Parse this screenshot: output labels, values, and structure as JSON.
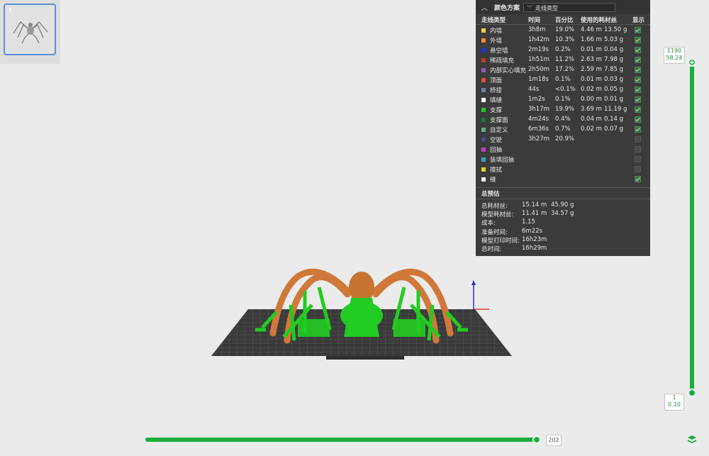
{
  "thumbnail": {
    "number": "1"
  },
  "panel": {
    "title": "颜色方案",
    "scheme": "走线类型",
    "columns": [
      "走线类型",
      "时间",
      "百分比",
      "使用的耗材丝",
      "显示"
    ],
    "rows": [
      {
        "color": "#f2d33c",
        "name": "内墙",
        "time": "3h8m",
        "pct": "19.0%",
        "len": "4.46 m",
        "weight": "13.50 g",
        "shown": true
      },
      {
        "color": "#f28c35",
        "name": "外墙",
        "time": "1h42m",
        "pct": "10.3%",
        "len": "1.66 m",
        "weight": "5.03 g",
        "shown": true
      },
      {
        "color": "#2033d9",
        "name": "悬空墙",
        "time": "2m19s",
        "pct": "0.2%",
        "len": "0.01 m",
        "weight": "0.04 g",
        "shown": true
      },
      {
        "color": "#c0392b",
        "name": "稀疏填充",
        "time": "1h51m",
        "pct": "11.2%",
        "len": "2.63 m",
        "weight": "7.98 g",
        "shown": true
      },
      {
        "color": "#9b59b6",
        "name": "内部实心填充",
        "time": "2h50m",
        "pct": "17.2%",
        "len": "2.59 m",
        "weight": "7.85 g",
        "shown": true
      },
      {
        "color": "#e74c3c",
        "name": "顶面",
        "time": "1m18s",
        "pct": "0.1%",
        "len": "0.01 m",
        "weight": "0.03 g",
        "shown": true
      },
      {
        "color": "#6b7fa8",
        "name": "桥接",
        "time": "44s",
        "pct": "<0.1%",
        "len": "0.02 m",
        "weight": "0.05 g",
        "shown": true
      },
      {
        "color": "#ffffff",
        "name": "填缝",
        "time": "1m2s",
        "pct": "0.1%",
        "len": "0.00 m",
        "weight": "0.01 g",
        "shown": true
      },
      {
        "color": "#22cc22",
        "name": "支撑",
        "time": "3h17m",
        "pct": "19.9%",
        "len": "3.69 m",
        "weight": "11.19 g",
        "shown": true
      },
      {
        "color": "#157a3a",
        "name": "支撑面",
        "time": "4m24s",
        "pct": "0.4%",
        "len": "0.04 m",
        "weight": "0.14 g",
        "shown": true
      },
      {
        "color": "#5fae7a",
        "name": "自定义",
        "time": "6m36s",
        "pct": "0.7%",
        "len": "0.02 m",
        "weight": "0.07 g",
        "shown": true
      },
      {
        "color": "#4a4a8a",
        "name": "空驶",
        "time": "3h27m",
        "pct": "20.9%",
        "len": "",
        "weight": "",
        "shown": false
      },
      {
        "color": "#c040c0",
        "name": "回抽",
        "time": "",
        "pct": "",
        "len": "",
        "weight": "",
        "shown": false
      },
      {
        "color": "#3aa0c8",
        "name": "装填回抽",
        "time": "",
        "pct": "",
        "len": "",
        "weight": "",
        "shown": false
      },
      {
        "color": "#e6d020",
        "name": "擦拭",
        "time": "",
        "pct": "",
        "len": "",
        "weight": "",
        "shown": false
      },
      {
        "color": "#f0f0f0",
        "name": "缝",
        "time": "",
        "pct": "",
        "len": "",
        "weight": "",
        "shown": true
      }
    ],
    "summary_title": "总预估",
    "summary": [
      {
        "label": "总耗材丝:",
        "a": "15.14 m",
        "b": "45.90 g"
      },
      {
        "label": "模型耗材丝:",
        "a": "11.41 m",
        "b": "34.57 g"
      },
      {
        "label": "成本:",
        "a": "1.15",
        "b": ""
      },
      {
        "label": "准备时间:",
        "a": "6m22s",
        "b": ""
      },
      {
        "label": "模型打印时间:",
        "a": "16h23m",
        "b": ""
      },
      {
        "label": "总时间:",
        "a": "16h29m",
        "b": ""
      }
    ]
  },
  "vslider": {
    "top_layer": "1190",
    "top_height": "58.24",
    "bottom_layer": "1",
    "bottom_height": "0.10",
    "top_fraction": 1.0,
    "bottom_fraction": 0.0
  },
  "hslider": {
    "value": "202",
    "fraction": 1.0
  },
  "colors": {
    "accent": "#1aae3e",
    "panel": "#3b3b3b",
    "support": "#22cc22",
    "wall": "#d87a35"
  },
  "icons": {
    "collapse": "chevron-up-icon",
    "dropdown": "chevron-down-icon",
    "layers": "layers-icon",
    "plus": "plus-icon"
  }
}
